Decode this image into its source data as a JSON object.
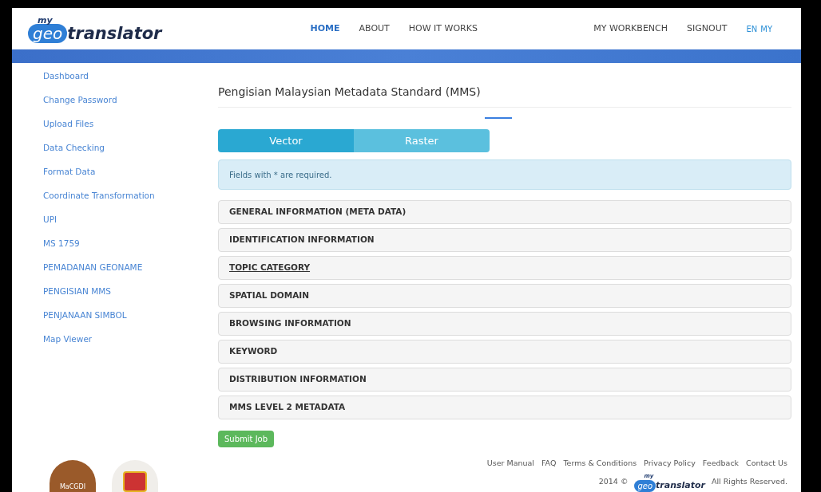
{
  "brand": {
    "small": "my",
    "first": "geo",
    "second": "translator"
  },
  "nav": [
    {
      "label": "HOME",
      "selected": true
    },
    {
      "label": "ABOUT",
      "selected": false
    },
    {
      "label": "HOW IT WORKS",
      "selected": false
    }
  ],
  "nav_right": [
    "MY WORKBENCH",
    "SIGNOUT"
  ],
  "languages": [
    "EN",
    "MY"
  ],
  "sidebar": {
    "items": [
      "Dashboard",
      "Change Password",
      "Upload Files",
      "Data Checking",
      "Format Data",
      "Coordinate Transformation",
      "UPI",
      "MS 1759",
      "PEMADANAN GEONAME",
      "PENGISIAN MMS",
      "PENJANAAN SIMBOL",
      "Map Viewer"
    ]
  },
  "page_title": "Pengisian Malaysian Metadata Standard (MMS)",
  "tabs": [
    {
      "label": "Vector",
      "selected": true
    },
    {
      "label": "Raster",
      "selected": false
    }
  ],
  "notice": "Fields with * are required.",
  "sections": [
    {
      "label": "GENERAL INFORMATION (META DATA)",
      "underlined": false
    },
    {
      "label": "IDENTIFICATION INFORMATION",
      "underlined": false
    },
    {
      "label": "TOPIC CATEGORY",
      "underlined": true
    },
    {
      "label": "SPATIAL DOMAIN",
      "underlined": false
    },
    {
      "label": "BROWSING INFORMATION",
      "underlined": false
    },
    {
      "label": "KEYWORD",
      "underlined": false
    },
    {
      "label": "DISTRIBUTION INFORMATION",
      "underlined": false
    },
    {
      "label": "MMS LEVEL 2 METADATA",
      "underlined": false
    }
  ],
  "submit_button": "Submit Job",
  "footer": {
    "logo_text": "MaCGDI",
    "brand": {
      "small": "my",
      "first": "geo",
      "second": "translator"
    },
    "links": [
      "User Manual",
      "FAQ",
      "Terms & Conditions",
      "Privacy Policy",
      "Feedback",
      "Contact Us"
    ],
    "year": "2014 ©",
    "rights": "All Rights Reserved."
  }
}
